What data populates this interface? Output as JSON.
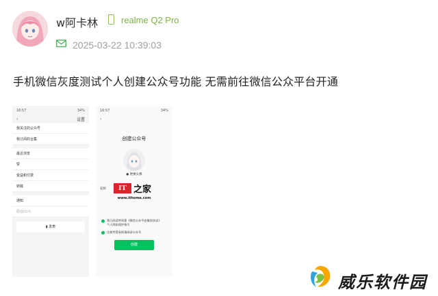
{
  "post": {
    "username": "w阿卡林",
    "device": "realme Q2 Pro",
    "timestamp": "2025-03-22 10:39:03",
    "text": "手机微信灰度测试个人创建公众号功能 无需前往微信公众平台开通"
  },
  "left_screenshot": {
    "status_time": "16:57",
    "status_battery": "34%",
    "nav_right": "设置",
    "rows": [
      "我关注的公众号",
      "我订阅的合集",
      "最近浏览",
      "赞",
      "受益和付费",
      "转载",
      "通知",
      "原创/公众"
    ],
    "publish_button": "发表"
  },
  "right_screenshot": {
    "status_time": "16:57",
    "status_battery": "34%",
    "title": "创建公众号",
    "avatar_caption": "更换头像",
    "name_label": "名称",
    "logo_it": "IT",
    "logo_zh": "之家",
    "logo_url": "www.ithome.com",
    "check_lines": [
      "我已阅读并同意《微信公众平台服务协议》",
      "个人隐私保护指引"
    ],
    "check_line2": "注册并登录前请阅读公众号",
    "create_button": "创建"
  },
  "watermark": {
    "text": "威乐软件园"
  },
  "colors": {
    "device_green": "#7cb342",
    "wechat_green": "#07c160",
    "it_red": "#d9262c"
  }
}
